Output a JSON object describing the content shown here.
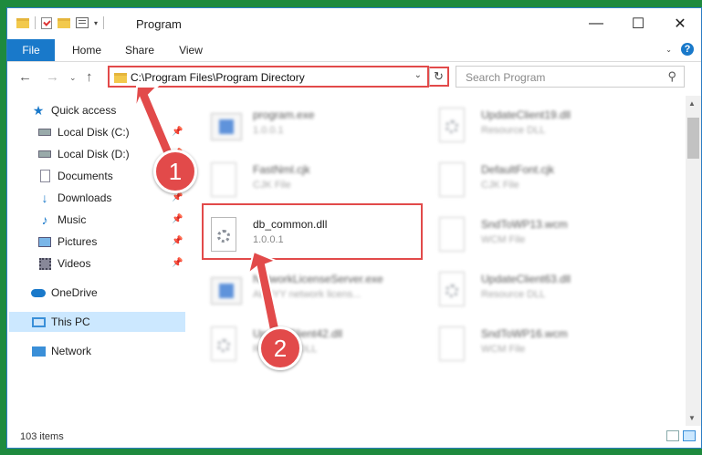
{
  "window": {
    "title": "Program",
    "buttons": {
      "minimize": "—",
      "maximize": "☐",
      "close": "✕"
    }
  },
  "ribbon": {
    "tabs": [
      "File",
      "Home",
      "Share",
      "View"
    ],
    "help": "?"
  },
  "address": {
    "path": "C:\\Program Files\\Program Directory",
    "search_placeholder": "Search Program"
  },
  "nav": {
    "quick_access": "Quick access",
    "items": [
      {
        "label": "Local Disk (C:)",
        "icon": "drive-icon",
        "pinned": true
      },
      {
        "label": "Local Disk (D:)",
        "icon": "drive-icon",
        "pinned": true
      },
      {
        "label": "Documents",
        "icon": "documents-icon",
        "pinned": true
      },
      {
        "label": "Downloads",
        "icon": "downloads-icon",
        "pinned": true
      },
      {
        "label": "Music",
        "icon": "music-icon",
        "pinned": true
      },
      {
        "label": "Pictures",
        "icon": "pictures-icon",
        "pinned": true
      },
      {
        "label": "Videos",
        "icon": "videos-icon",
        "pinned": true
      }
    ],
    "onedrive": "OneDrive",
    "this_pc": "This PC",
    "network": "Network"
  },
  "files": [
    {
      "name": "program.exe",
      "sub": "1.0.0.1",
      "icon": "exe-icon",
      "blurred": true
    },
    {
      "name": "UpdateClient19.dll",
      "sub": "Resource DLL",
      "icon": "dll-icon",
      "blurred": true
    },
    {
      "name": "FastNml.cjk",
      "sub": "CJK File",
      "icon": "file-icon",
      "blurred": true
    },
    {
      "name": "DefaultFont.cjk",
      "sub": "CJK File",
      "icon": "file-icon",
      "blurred": true
    },
    {
      "name": "db_common.dll",
      "sub": "1.0.0.1",
      "icon": "dll-icon",
      "blurred": false,
      "highlighted": true
    },
    {
      "name": "SndToWP13.wcm",
      "sub": "WCM File",
      "icon": "file-icon",
      "blurred": true
    },
    {
      "name": "NetworkLicenseServer.exe",
      "sub": "ABBYY network licens...",
      "icon": "exe-icon",
      "blurred": true
    },
    {
      "name": "UpdateClient63.dll",
      "sub": "Resource DLL",
      "icon": "dll-icon",
      "blurred": true
    },
    {
      "name": "UpdateClient42.dll",
      "sub": "Resource DLL",
      "icon": "dll-icon",
      "blurred": true
    },
    {
      "name": "SndToWP16.wcm",
      "sub": "WCM File",
      "icon": "file-icon",
      "blurred": true
    }
  ],
  "status": {
    "item_count": "103 items"
  },
  "callouts": [
    "1",
    "2"
  ],
  "colors": {
    "accent": "#1979ca",
    "annotation": "#e24a4a",
    "selection": "#cce8ff"
  }
}
